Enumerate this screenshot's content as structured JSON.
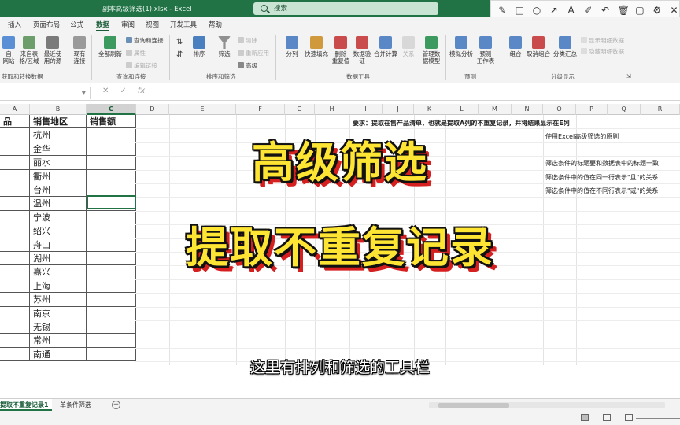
{
  "window": {
    "title": "副本高级筛选(1).xlsx  -  Excel",
    "search_placeholder": "搜索"
  },
  "menu_tabs": [
    {
      "label": "插入"
    },
    {
      "label": "页面布局"
    },
    {
      "label": "公式"
    },
    {
      "label": "数据",
      "active": true
    },
    {
      "label": "审阅"
    },
    {
      "label": "视图"
    },
    {
      "label": "开发工具"
    },
    {
      "label": "帮助"
    }
  ],
  "ribbon": {
    "get_data": {
      "btn_from_web": "自\n网站",
      "btn_from_table": "来自表\n格/区域",
      "btn_recent": "最近使\n用的源",
      "btn_existing": "现有\n连接",
      "group_label": "获取和转换数据"
    },
    "queries": {
      "btn_refresh_all": "全部刷新",
      "queries_connections": "查询和连接",
      "properties": "属性",
      "edit_links": "编辑链接",
      "group_label": "查询和连接"
    },
    "sort_filter": {
      "btn_sort": "排序",
      "btn_filter": "筛选",
      "clear": "清除",
      "reapply": "重新应用",
      "advanced": "高级",
      "group_label": "排序和筛选"
    },
    "data_tools": {
      "btn_text_to_columns": "分列",
      "btn_flash_fill": "快速填充",
      "btn_remove_duplicates": "删除\n重复值",
      "btn_validation": "数据验\n证",
      "btn_consolidate": "合并计算",
      "btn_relationships": "关系",
      "btn_data_model": "管理数\n据模型",
      "group_label": "数据工具"
    },
    "forecast": {
      "btn_what_if": "模拟分析",
      "btn_forecast_sheet": "预测\n工作表",
      "group_label": "预测"
    },
    "outline": {
      "btn_group": "组合",
      "btn_ungroup": "取消组合",
      "btn_subtotal": "分类汇总",
      "show_detail": "显示明细数据",
      "hide_detail": "隐藏明细数据",
      "group_label": "分级显示"
    }
  },
  "column_headers": [
    "A",
    "B",
    "C",
    "D",
    "E",
    "F",
    "G",
    "H",
    "I",
    "J",
    "K",
    "L",
    "M",
    "N",
    "O",
    "P",
    "Q",
    "R"
  ],
  "sheet": {
    "header_row": {
      "a": "品",
      "b": "销售地区",
      "c": "销售额"
    },
    "regions": [
      "杭州",
      "金华",
      "丽水",
      "衢州",
      "台州",
      "温州",
      "宁波",
      "绍兴",
      "舟山",
      "湖州",
      "嘉兴",
      "上海",
      "苏州",
      "南京",
      "无锡",
      "常州",
      "南通"
    ],
    "notes": {
      "requirement": "要求：提取在售产品清单，也就是提取A列的不重复记录，并将结果显示在E列",
      "principle": "使用Excel高级筛选的原则",
      "rule1": "筛选条件的标题要和数据表中的标题一致",
      "rule2": "筛选条件中的值在同一行表示\"且\"的关系",
      "rule3": "筛选条件中的值在不同行表示\"或\"的关系"
    }
  },
  "overlay": {
    "title_line1": "高级筛选",
    "title_line2": "提取不重复记录",
    "subtitle": "这里有排列和筛选的工具栏"
  },
  "sheet_tabs": [
    {
      "label": "提取不重复记录1",
      "active": true
    },
    {
      "label": "单条件筛选"
    }
  ],
  "colors": {
    "excel_green": "#217346",
    "title_yellow": "#ffe533",
    "title_shadow_red": "#d62020"
  }
}
